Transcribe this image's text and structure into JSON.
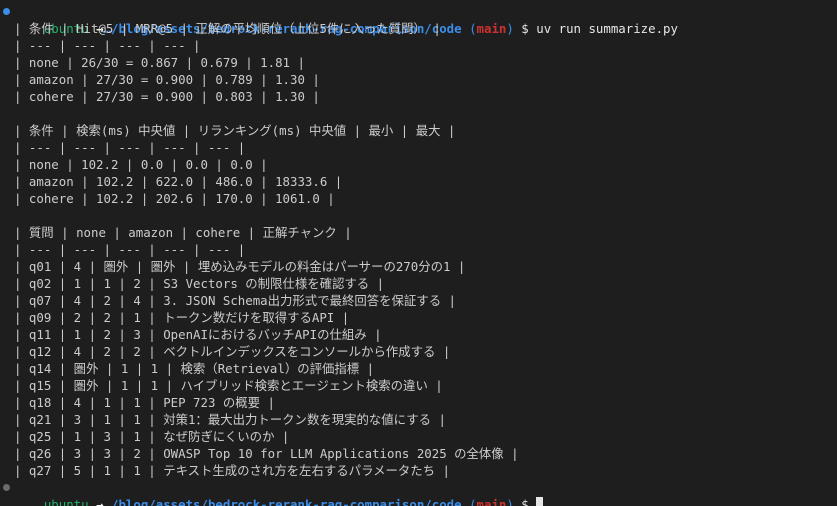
{
  "theme": {
    "background": "#1e1e1e",
    "text": "#cccccc",
    "user": "#25b36b",
    "path": "#3b8eea",
    "branch": "#cd3131",
    "dot_done": "#3b8eea",
    "dot_idle": "#6b6b6b"
  },
  "prompt_top": {
    "user": "ubuntu",
    "arrow": " →",
    "path": "…/blog/assets/bedrock-rerank-rag-comparison/code",
    "branch_open": " (",
    "branch": "main",
    "branch_close": ")",
    "symbol": " $ ",
    "command": "uv run summarize.py"
  },
  "lines": [
    "| 条件 | Hit@5 | MRR@5 | 正解の平均順位（上位5件に入った質問） |",
    "| --- | --- | --- | --- |",
    "| none | 26/30 = 0.867 | 0.679 | 1.81 |",
    "| amazon | 27/30 = 0.900 | 0.789 | 1.30 |",
    "| cohere | 27/30 = 0.900 | 0.803 | 1.30 |",
    "",
    "| 条件 | 検索(ms) 中央値 | リランキング(ms) 中央値 | 最小 | 最大 |",
    "| --- | --- | --- | --- | --- |",
    "| none | 102.2 | 0.0 | 0.0 | 0.0 |",
    "| amazon | 102.2 | 622.0 | 486.0 | 18333.6 |",
    "| cohere | 102.2 | 202.6 | 170.0 | 1061.0 |",
    "",
    "| 質問 | none | amazon | cohere | 正解チャンク |",
    "| --- | --- | --- | --- | --- |",
    "| q01 | 4 | 圏外 | 圏外 | 埋め込みモデルの料金はパーサーの270分の1 |",
    "| q02 | 1 | 1 | 2 | S3 Vectors の制限仕様を確認する |",
    "| q07 | 4 | 2 | 4 | 3. JSON Schema出力形式で最終回答を保証する |",
    "| q09 | 2 | 2 | 1 | トークン数だけを取得するAPI |",
    "| q11 | 1 | 2 | 3 | OpenAIにおけるバッチAPIの仕組み |",
    "| q12 | 4 | 2 | 2 | ベクトルインデックスをコンソールから作成する |",
    "| q14 | 圏外 | 1 | 1 | 検索（Retrieval）の評価指標 |",
    "| q15 | 圏外 | 1 | 1 | ハイブリッド検索とエージェント検索の違い |",
    "| q18 | 4 | 1 | 1 | PEP 723 の概要 |",
    "| q21 | 3 | 1 | 1 | 対策1：最大出力トークン数を現実的な値にする |",
    "| q25 | 1 | 3 | 1 | なぜ防ぎにくいのか |",
    "| q26 | 3 | 3 | 2 | OWASP Top 10 for LLM Applications 2025 の全体像 |",
    "| q27 | 5 | 1 | 1 | テキスト生成のされ方を左右するパラメータたち |"
  ],
  "prompt_bottom": {
    "user": "ubuntu",
    "arrow": " →",
    "path": "…/blog/assets/bedrock-rerank-rag-comparison/code",
    "branch_open": " (",
    "branch": "main",
    "branch_close": ")",
    "symbol": " $ "
  }
}
